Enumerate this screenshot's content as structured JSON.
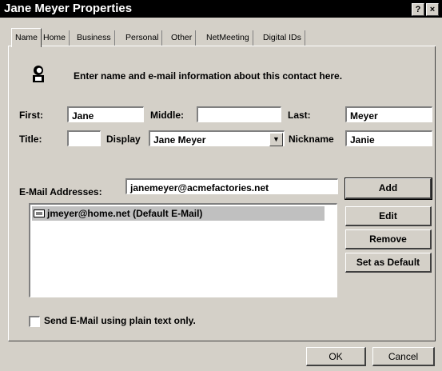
{
  "window": {
    "title": "Jane Meyer Properties",
    "help_label": "?",
    "close_label": "×"
  },
  "tabs": [
    {
      "label": "Name",
      "active": true
    },
    {
      "label": "Home"
    },
    {
      "label": "Business"
    },
    {
      "label": "Personal"
    },
    {
      "label": "Other"
    },
    {
      "label": "NetMeeting"
    },
    {
      "label": "Digital IDs"
    }
  ],
  "header": {
    "instruction": "Enter name and e-mail information about this contact here."
  },
  "name_fields": {
    "first_label": "First:",
    "first_value": "Jane",
    "middle_label": "Middle:",
    "middle_value": "",
    "last_label": "Last:",
    "last_value": "Meyer",
    "title_label": "Title:",
    "title_value": "",
    "display_label": "Display",
    "display_value": "Jane Meyer",
    "nickname_label": "Nickname",
    "nickname_value": "Janie"
  },
  "email": {
    "label": "E-Mail Addresses:",
    "input_value": "janemeyer@acmefactories.net",
    "list": [
      "jmeyer@home.net  (Default E-Mail)"
    ],
    "buttons": {
      "add": "Add",
      "edit": "Edit",
      "remove": "Remove",
      "set_default": "Set as Default"
    }
  },
  "plain_text": {
    "label": "Send E-Mail using plain text only.",
    "checked": false
  },
  "footer": {
    "ok": "OK",
    "cancel": "Cancel"
  }
}
